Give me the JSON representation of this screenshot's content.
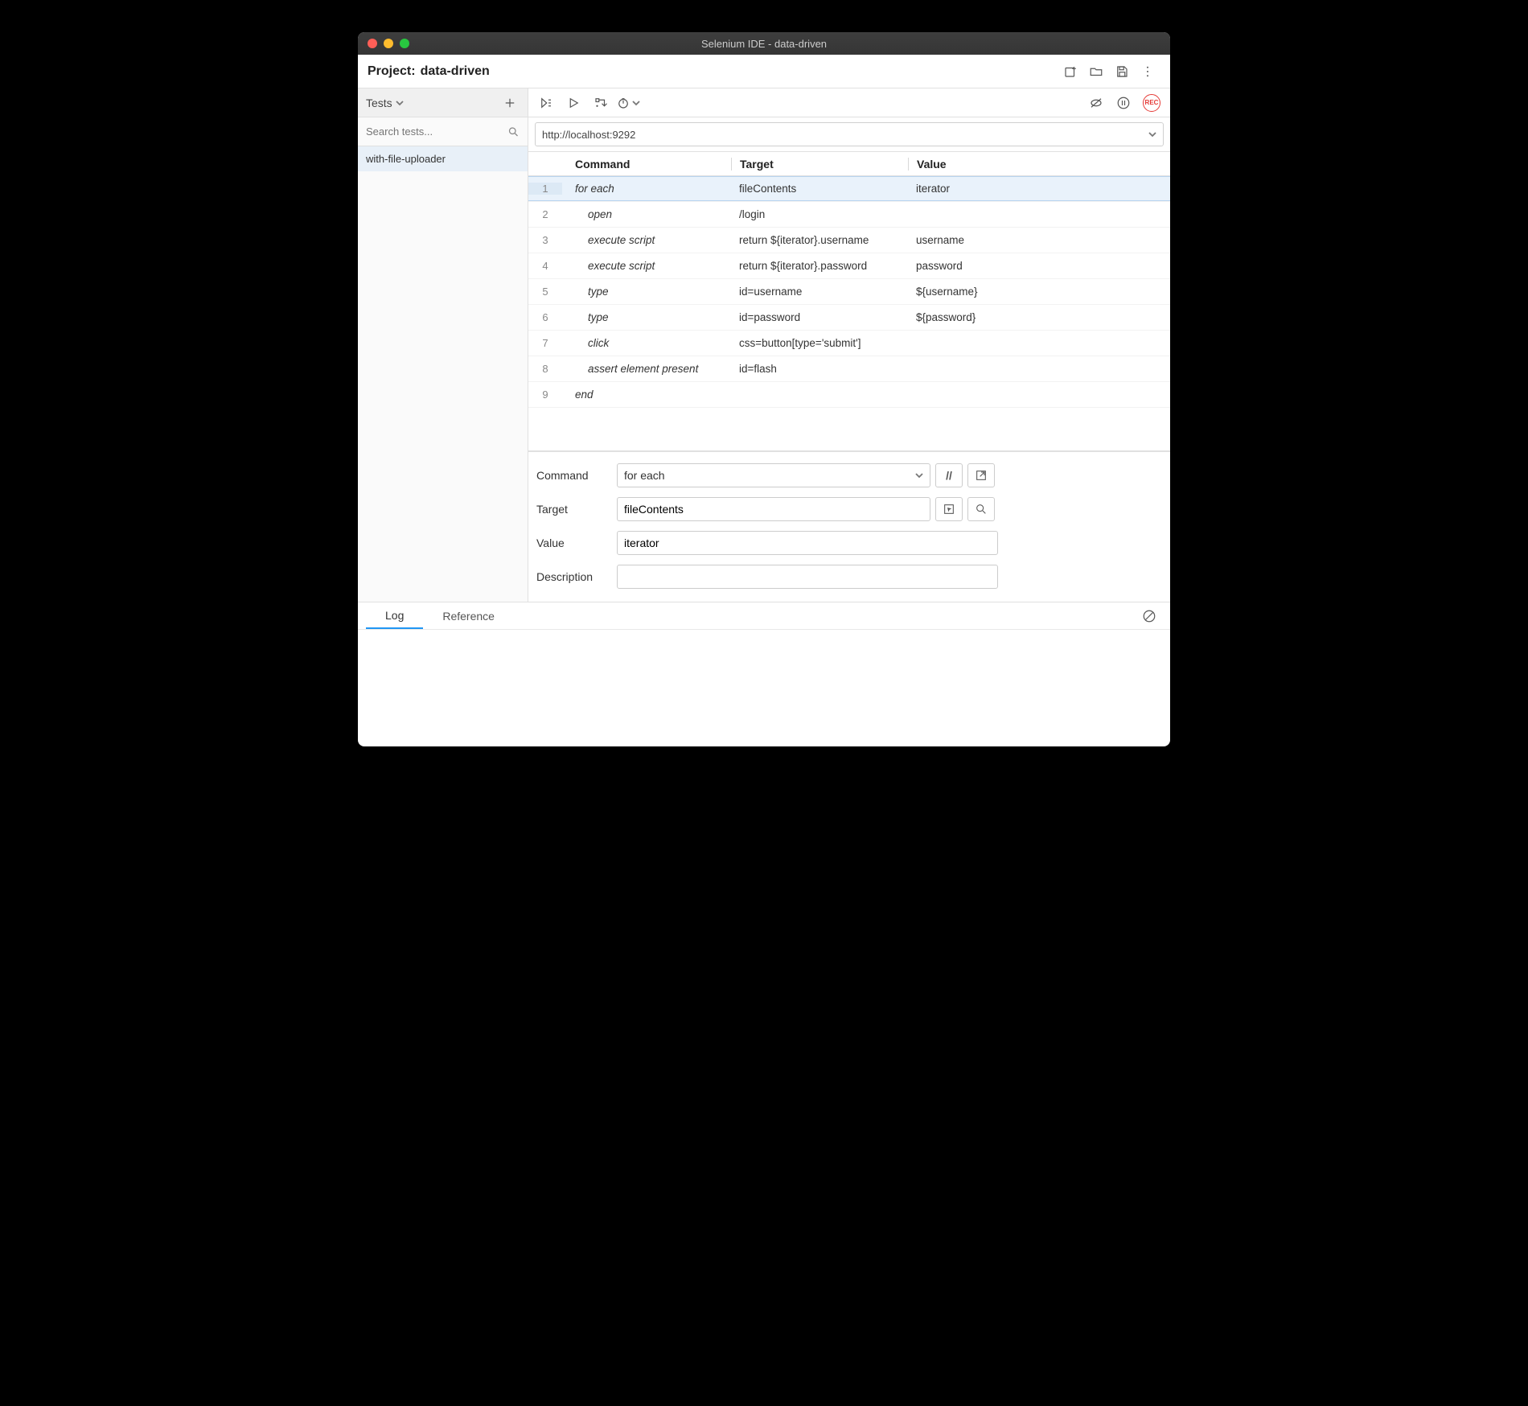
{
  "window": {
    "title": "Selenium IDE - data-driven"
  },
  "project": {
    "label": "Project:",
    "name": "data-driven"
  },
  "sidebar": {
    "tab_label": "Tests",
    "search_placeholder": "Search tests...",
    "items": [
      {
        "name": "with-file-uploader",
        "selected": true
      }
    ]
  },
  "url": "http://localhost:9292",
  "headers": {
    "command": "Command",
    "target": "Target",
    "value": "Value"
  },
  "commands": [
    {
      "n": "1",
      "cmd": "for each",
      "target": "fileContents",
      "value": "iterator",
      "indent": false,
      "selected": true
    },
    {
      "n": "2",
      "cmd": "open",
      "target": "/login",
      "value": "",
      "indent": true
    },
    {
      "n": "3",
      "cmd": "execute script",
      "target": "return ${iterator}.username",
      "value": "username",
      "indent": true
    },
    {
      "n": "4",
      "cmd": "execute script",
      "target": "return ${iterator}.password",
      "value": "password",
      "indent": true
    },
    {
      "n": "5",
      "cmd": "type",
      "target": "id=username",
      "value": "${username}",
      "indent": true
    },
    {
      "n": "6",
      "cmd": "type",
      "target": "id=password",
      "value": "${password}",
      "indent": true
    },
    {
      "n": "7",
      "cmd": "click",
      "target": "css=button[type='submit']",
      "value": "",
      "indent": true
    },
    {
      "n": "8",
      "cmd": "assert element present",
      "target": "id=flash",
      "value": "",
      "indent": true
    },
    {
      "n": "9",
      "cmd": "end",
      "target": "",
      "value": "",
      "indent": false
    }
  ],
  "editor": {
    "command_label": "Command",
    "command_value": "for each",
    "target_label": "Target",
    "target_value": "fileContents",
    "value_label": "Value",
    "value_value": "iterator",
    "description_label": "Description",
    "description_value": ""
  },
  "editor_buttons": {
    "comment": "//"
  },
  "tabs": {
    "log": "Log",
    "reference": "Reference"
  },
  "rec_label": "REC"
}
